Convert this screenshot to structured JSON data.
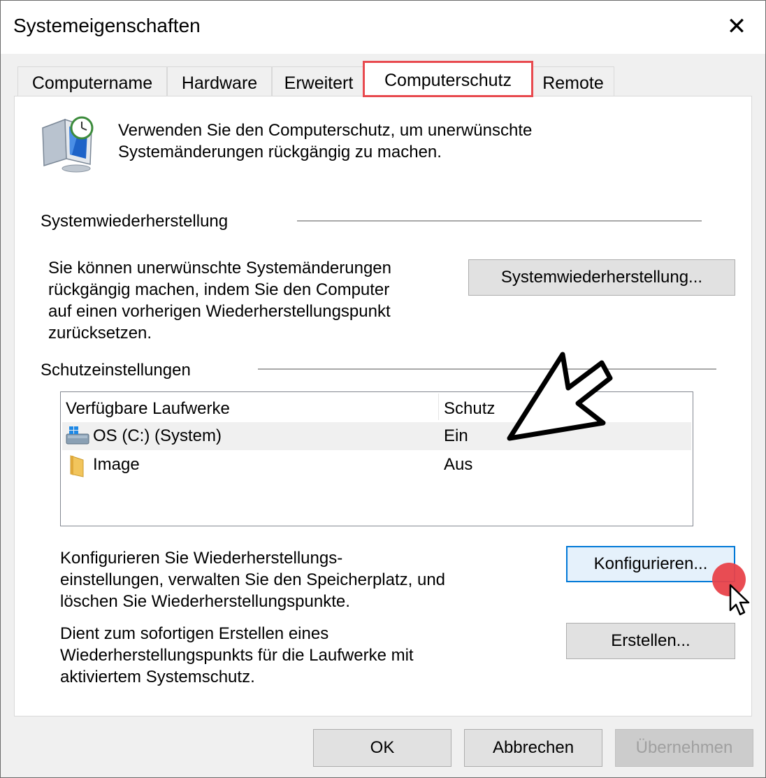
{
  "window": {
    "title": "Systemeigenschaften",
    "close_glyph": "✕"
  },
  "tabs": [
    {
      "label": "Computername",
      "active": false
    },
    {
      "label": "Hardware",
      "active": false
    },
    {
      "label": "Erweitert",
      "active": false
    },
    {
      "label": "Computerschutz",
      "active": true
    },
    {
      "label": "Remote",
      "active": false
    }
  ],
  "header": {
    "icon": "system-protection-monitor-clock-icon",
    "description": "Verwenden Sie den Computerschutz, um unerwünschte\nSystemänderungen rückgängig zu machen."
  },
  "restore": {
    "section_title": "Systemwiederherstellung",
    "description": "Sie können unerwünschte Systemänderungen\nrückgängig machen, indem Sie den Computer\nauf einen vorherigen Wiederherstellungspunkt\nzurücksetzen.",
    "button_label": "Systemwiederherstellung..."
  },
  "protection": {
    "section_title": "Schutzeinstellungen",
    "columns": [
      "Verfügbare Laufwerke",
      "Schutz"
    ],
    "drives": [
      {
        "name": "OS (C:) (System)",
        "protection": "Ein",
        "icon": "windows-drive-icon",
        "selected": true
      },
      {
        "name": "Image",
        "protection": "Aus",
        "icon": "folder-drive-icon",
        "selected": false
      }
    ],
    "configure_text": "Konfigurieren Sie Wiederherstellungs-\neinstellungen, verwalten Sie den Speicherplatz, und\nlöschen Sie Wiederherstellungspunkte.",
    "configure_button": "Konfigurieren...",
    "create_text": "Dient zum sofortigen Erstellen eines\nWiederherstellungspunkts für die Laufwerke mit\naktiviertem Systemschutz.",
    "create_button": "Erstellen..."
  },
  "footer": {
    "ok": "OK",
    "cancel": "Abbrechen",
    "apply": "Übernehmen",
    "apply_enabled": false
  },
  "colors": {
    "highlight_red": "#e84a4f",
    "focus_blue": "#0078d7",
    "click_dot": "#e8424a"
  }
}
